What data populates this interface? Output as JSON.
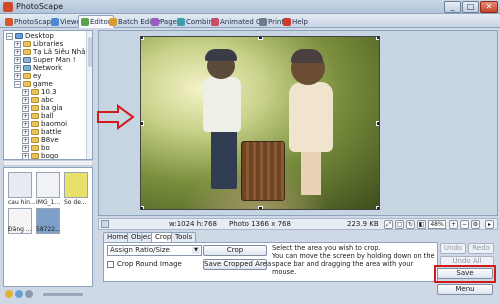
{
  "window": {
    "title": "PhotoScape",
    "controls": [
      "_",
      "□",
      "✕"
    ]
  },
  "tabs": [
    {
      "label": "PhotoScape",
      "icon": "photoscape-icon",
      "color": "#d4582e"
    },
    {
      "label": "Viewer",
      "icon": "viewer-icon",
      "color": "#4a8bd1"
    },
    {
      "label": "Editor",
      "icon": "editor-icon",
      "color": "#5aa34b",
      "active": true
    },
    {
      "label": "Batch Editor",
      "icon": "batch-editor-icon",
      "color": "#d99b2c"
    },
    {
      "label": "Page",
      "icon": "page-icon",
      "color": "#9d5bc4"
    },
    {
      "label": "Combine",
      "icon": "combine-icon",
      "color": "#3b9fb0"
    },
    {
      "label": "Animated GIF",
      "icon": "animated-gif-icon",
      "color": "#cc4a6a"
    },
    {
      "label": "Print",
      "icon": "print-icon",
      "color": "#6e7a8a"
    },
    {
      "label": "Help",
      "icon": "help-icon",
      "color": "#d13a2a"
    }
  ],
  "tree": [
    {
      "label": "Desktop",
      "level": 0,
      "expander": "−"
    },
    {
      "label": "Libraries",
      "level": 1,
      "expander": "+"
    },
    {
      "label": "Tạ Lã Siêu Nhân",
      "level": 1,
      "expander": "+"
    },
    {
      "label": "Super Man !",
      "level": 1,
      "expander": "+"
    },
    {
      "label": "Network",
      "level": 1,
      "expander": "+"
    },
    {
      "label": "ey",
      "level": 1,
      "expander": "+"
    },
    {
      "label": "game",
      "level": 1,
      "expander": "−"
    },
    {
      "label": "10.3",
      "level": 2,
      "expander": "+"
    },
    {
      "label": "abc",
      "level": 2,
      "expander": "+"
    },
    {
      "label": "ba gia",
      "level": 2,
      "expander": "+"
    },
    {
      "label": "ball",
      "level": 2,
      "expander": "+"
    },
    {
      "label": "baomoi",
      "level": 2,
      "expander": "+"
    },
    {
      "label": "battle",
      "level": 2,
      "expander": "+"
    },
    {
      "label": "B8ve",
      "level": 2,
      "expander": "+"
    },
    {
      "label": "bo",
      "level": 2,
      "expander": "+"
    },
    {
      "label": "bogo",
      "level": 2,
      "expander": "+"
    },
    {
      "label": "...",
      "level": 2,
      "expander": "+"
    }
  ],
  "thumbnails": [
    {
      "label": "cau hin...",
      "color": "#e8ecf2"
    },
    {
      "label": "IMG_1...",
      "color": "#f0f2f5"
    },
    {
      "label": "So de...",
      "color": "#e9e26a"
    },
    {
      "label": "Đăng ...",
      "color": "#f4f4f4"
    },
    {
      "label": "58722...",
      "color": "#7ea0c8"
    }
  ],
  "status": {
    "size": "w:1024 h:768",
    "photo": "Photo 1366 x 768",
    "file_size": "223.9 KB",
    "zoom": "48%"
  },
  "subtabs": [
    "Home",
    "Object",
    "Crop",
    "Tools"
  ],
  "crop": {
    "ratio_select": "Assign Ratio/Size",
    "crop_button": "Crop",
    "round_image_label": "Crop Round Image",
    "save_cropped_button": "Save Cropped Area",
    "hint": "Select the area you wish to crop.\nYou can move the screen by holding down on the space bar and dragging the area with your mouse."
  },
  "actions": {
    "undo": "Undo",
    "redo": "Redo",
    "undo_all": "Undo All",
    "save": "Save",
    "menu": "Menu"
  },
  "colors": {
    "highlight": "#d11a1a",
    "arrow": "#d11a1a"
  }
}
